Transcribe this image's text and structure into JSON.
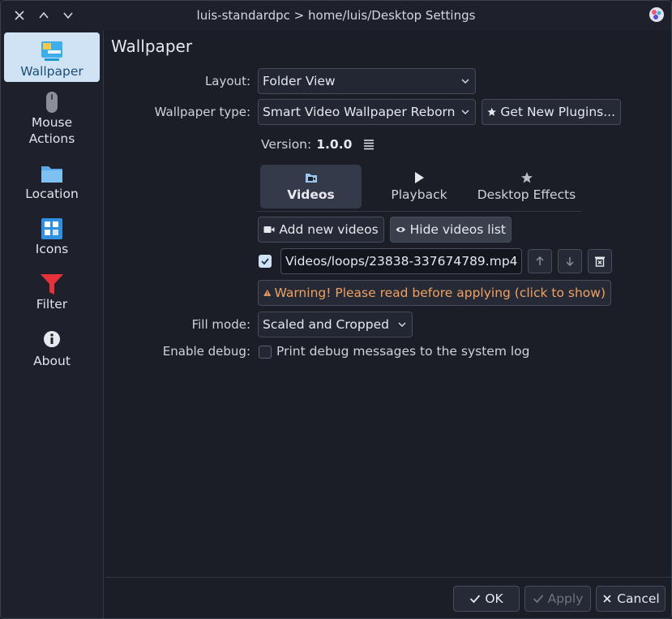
{
  "window": {
    "title": "luis-standardpc > home/luis/Desktop Settings"
  },
  "sidebar": {
    "items": [
      {
        "label": "Wallpaper",
        "icon": "wallpaper-icon",
        "active": true
      },
      {
        "label": "Mouse\nActions",
        "icon": "mouse-icon",
        "active": false
      },
      {
        "label": "Location",
        "icon": "folder-icon",
        "active": false
      },
      {
        "label": "Icons",
        "icon": "icons-grid-icon",
        "active": false
      },
      {
        "label": "Filter",
        "icon": "filter-icon",
        "active": false
      },
      {
        "label": "About",
        "icon": "info-icon",
        "active": false
      }
    ]
  },
  "main": {
    "title": "Wallpaper",
    "layout_label": "Layout:",
    "layout_value": "Folder View",
    "wallpaper_type_label": "Wallpaper type:",
    "wallpaper_type_value": "Smart Video Wallpaper Reborn",
    "get_plugins_label": "Get New Plugins...",
    "version_label": "Version:",
    "version_value": "1.0.0",
    "tabs": [
      {
        "label": "Videos",
        "icon": "video-folder-icon",
        "active": true
      },
      {
        "label": "Playback",
        "icon": "play-icon",
        "active": false
      },
      {
        "label": "Desktop Effects",
        "icon": "star-icon",
        "active": false
      }
    ],
    "add_videos_label": "Add new videos",
    "hide_list_label": "Hide videos list",
    "video_entry": {
      "checked": true,
      "path": "Videos/loops/23838-337674789.mp4"
    },
    "warning_text": "Warning! Please read before applying (click to show)",
    "fill_mode_label": "Fill mode:",
    "fill_mode_value": "Scaled and Cropped",
    "debug_label": "Enable debug:",
    "debug_checkbox_label": "Print debug messages to the system log",
    "debug_checked": false
  },
  "footer": {
    "ok_label": "OK",
    "apply_label": "Apply",
    "cancel_label": "Cancel"
  },
  "colors": {
    "accent": "#cfe3f5",
    "warning": "#f0a060",
    "background": "#1b1e27"
  }
}
